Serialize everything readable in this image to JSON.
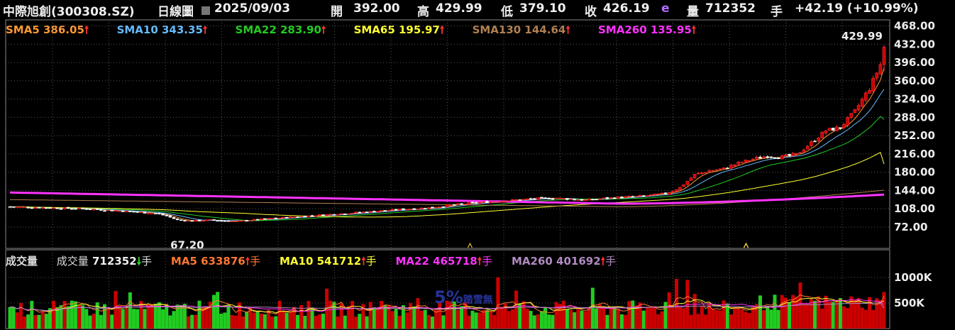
{
  "header": {
    "stock": "中際旭創(300308.SZ)",
    "chart_kind": "日線圖",
    "date": "2025/09/03",
    "open_label": "開",
    "open": "392.00",
    "high_label": "高",
    "high": "429.99",
    "low_label": "低",
    "low": "379.10",
    "close_label": "收",
    "close": "426.19",
    "e_mark": "e",
    "vol_label": "量",
    "vol": "712352",
    "vol_unit": "手",
    "change": "+42.19 (+10.99%)"
  },
  "ma_legend": [
    {
      "text": "SMA5 386.05",
      "color": "#ff9933"
    },
    {
      "text": "SMA10 343.35",
      "color": "#66bbff"
    },
    {
      "text": "SMA22 283.90",
      "color": "#22cc22"
    },
    {
      "text": "SMA65 195.97",
      "color": "#ffff33"
    },
    {
      "text": "SMA130 144.64",
      "color": "#b08050"
    },
    {
      "text": "SMA260 135.95",
      "color": "#ff33ff"
    }
  ],
  "vol_legend": {
    "title": "成交量",
    "cur_label": "成交量",
    "cur_value": "712352",
    "unit": "手",
    "items": [
      {
        "text": "MA5 633876",
        "color": "#ff7733"
      },
      {
        "text": "MA10 541712",
        "color": "#ffff33"
      },
      {
        "text": "MA22 465718",
        "color": "#ff33ff"
      },
      {
        "text": "MA260 401692",
        "color": "#b08ac0"
      }
    ]
  },
  "watermark": {
    "main": "5%",
    "sub": "踏雪無"
  },
  "chart_data": [
    {
      "type": "candlestick",
      "y_ticks": [
        "468.00",
        "432.00",
        "396.00",
        "360.00",
        "324.00",
        "288.00",
        "252.00",
        "216.00",
        "180.00",
        "144.00",
        "108.00",
        "72.00"
      ],
      "ylim": [
        30,
        480
      ],
      "annotations": {
        "high": "429.99",
        "low": "67.20"
      },
      "up_color": "#cc0000",
      "down_color": "#ffffff",
      "series": [
        {
          "name": "SMA5",
          "color": "#ff9933"
        },
        {
          "name": "SMA10",
          "color": "#66bbff"
        },
        {
          "name": "SMA22",
          "color": "#22cc22"
        },
        {
          "name": "SMA65",
          "color": "#ffff33"
        },
        {
          "name": "SMA130",
          "color": "#b08050"
        },
        {
          "name": "SMA260",
          "color": "#ff33ff"
        }
      ],
      "anchors": [
        [
          0,
          112
        ],
        [
          10,
          110
        ],
        [
          20,
          108
        ],
        [
          30,
          104
        ],
        [
          40,
          99
        ],
        [
          43,
          94
        ],
        [
          46,
          86
        ],
        [
          50,
          84
        ],
        [
          55,
          86
        ],
        [
          62,
          83
        ],
        [
          70,
          88
        ],
        [
          78,
          92
        ],
        [
          86,
          96
        ],
        [
          92,
          99
        ],
        [
          100,
          103
        ],
        [
          108,
          107
        ],
        [
          115,
          110
        ],
        [
          122,
          116
        ],
        [
          130,
          121
        ],
        [
          138,
          125
        ],
        [
          145,
          128
        ],
        [
          150,
          129
        ],
        [
          158,
          125
        ],
        [
          166,
          130
        ],
        [
          174,
          133
        ],
        [
          180,
          138
        ],
        [
          184,
          150
        ],
        [
          188,
          175
        ],
        [
          192,
          183
        ],
        [
          196,
          187
        ],
        [
          200,
          198
        ],
        [
          204,
          206
        ],
        [
          208,
          212
        ],
        [
          212,
          210
        ],
        [
          216,
          215
        ],
        [
          220,
          238
        ],
        [
          224,
          262
        ],
        [
          228,
          268
        ],
        [
          232,
          300
        ],
        [
          236,
          345
        ],
        [
          239,
          392
        ],
        [
          240,
          426
        ]
      ],
      "open_last": 392,
      "high_last": 429.99,
      "low_last": 379.1,
      "close_last": 426.19,
      "sma_last": [
        386.05,
        343.35,
        283.9,
        195.97,
        144.64,
        135.95
      ]
    },
    {
      "type": "bar",
      "y_ticks": [
        "1000K",
        "500K"
      ],
      "ylim": [
        0,
        1150000
      ],
      "last_value": 712352,
      "ma_last": [
        633876,
        541712,
        465718,
        401692
      ],
      "bar_up_color": "#cc0000",
      "bar_down_color": "#22cc22"
    }
  ]
}
